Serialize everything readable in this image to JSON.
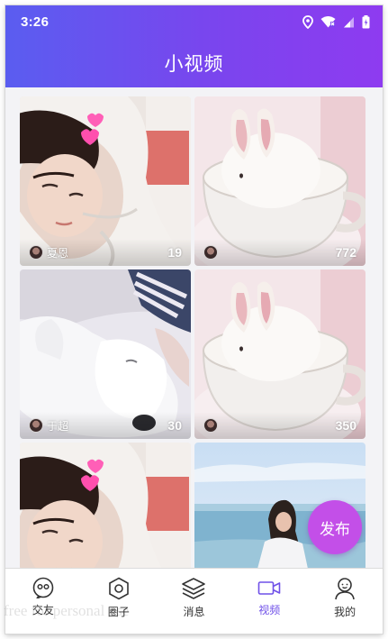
{
  "status_bar": {
    "time": "3:26",
    "icons": [
      "location-icon",
      "wifi-icon",
      "signal-icon",
      "battery-icon"
    ]
  },
  "header": {
    "title": "小视频",
    "gradient": [
      "#5a5df0",
      "#8e3bf0"
    ]
  },
  "videos": [
    {
      "author": "夏恩",
      "likes": "19",
      "thumbnail": "girl-in-hoodie"
    },
    {
      "author": "",
      "likes": "772",
      "thumbnail": "bunny-in-cup"
    },
    {
      "author": "于超",
      "likes": "30",
      "thumbnail": "sleeping-white-dog"
    },
    {
      "author": "",
      "likes": "350",
      "thumbnail": "bunny-in-cup"
    },
    {
      "author": "",
      "likes": "",
      "thumbnail": "girl-in-hoodie"
    },
    {
      "author": "",
      "likes": "",
      "thumbnail": "girl-at-seaside"
    }
  ],
  "fab": {
    "label": "发布",
    "color": "#c34fe8"
  },
  "tabbar": {
    "active_color": "#6f50e8",
    "items": [
      {
        "label": "交友",
        "icon": "chat-bubbles-icon",
        "active": false
      },
      {
        "label": "圈子",
        "icon": "hexagon-icon",
        "active": false
      },
      {
        "label": "消息",
        "icon": "layers-icon",
        "active": false
      },
      {
        "label": "视频",
        "icon": "video-camera-icon",
        "active": true
      },
      {
        "label": "我的",
        "icon": "person-icon",
        "active": false
      }
    ]
  },
  "watermark": "free for personal use"
}
